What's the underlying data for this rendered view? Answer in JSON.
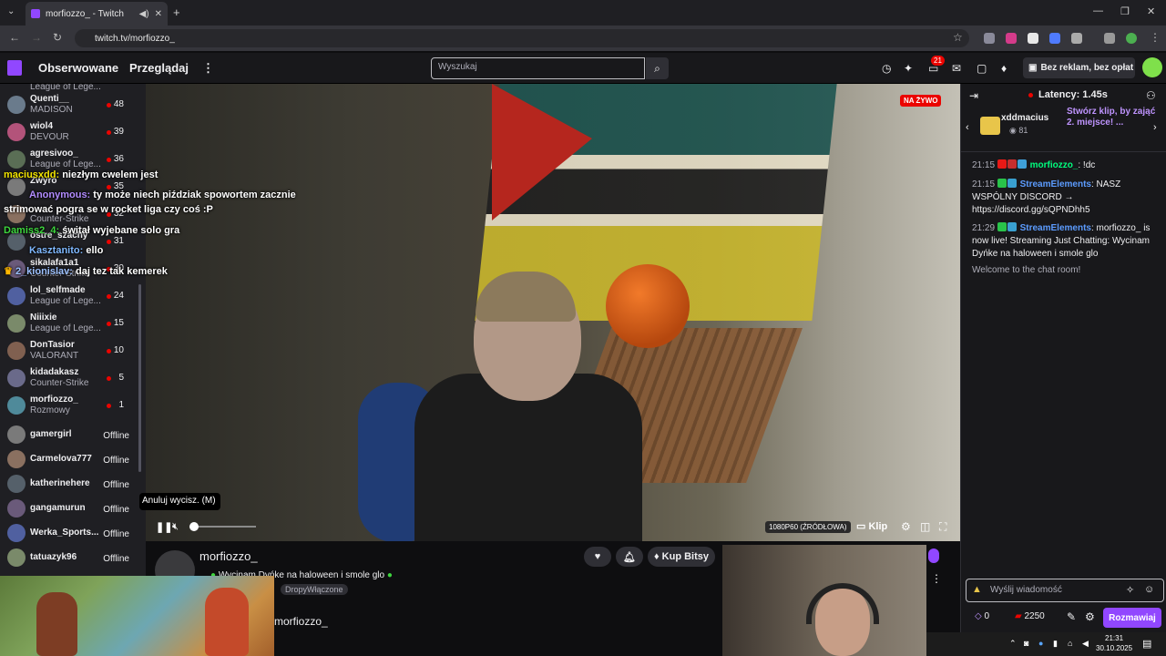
{
  "browser": {
    "tab_title": "morfiozzo_ - Twitch",
    "url": "twitch.tv/morfiozzo_"
  },
  "nav": {
    "following": "Obserwowane",
    "browse": "Przeglądaj",
    "search_placeholder": "Wyszukaj",
    "notif_count": "21",
    "adfree": "Bez reklam, bez opłat"
  },
  "sidebar": {
    "top_partial": "League of Lege...",
    "channels": [
      {
        "name": "Quenti__",
        "game": "MADISON",
        "viewers": "48"
      },
      {
        "name": "wiol4",
        "game": "DEVOUR",
        "viewers": "39"
      },
      {
        "name": "agresivoo_",
        "game": "League of Lege...",
        "viewers": "36"
      },
      {
        "name": "Zwyro",
        "game": "",
        "viewers": "35"
      },
      {
        "name": "",
        "game": "Counter-Strike",
        "viewers": "32"
      },
      {
        "name": "ostre_szachy",
        "game": "",
        "viewers": "31"
      },
      {
        "name": "sikalafa1a1",
        "game": "Counter-Strike",
        "viewers": "30"
      },
      {
        "name": "lol_selfmade",
        "game": "League of Lege...",
        "viewers": "24"
      },
      {
        "name": "Niiixie",
        "game": "League of Lege...",
        "viewers": "15"
      },
      {
        "name": "DonTasior",
        "game": "VALORANT",
        "viewers": "10"
      },
      {
        "name": "kidadakasz",
        "game": "Counter-Strike",
        "viewers": "5"
      },
      {
        "name": "morfiozzo_",
        "game": "Rozmowy",
        "viewers": "1"
      }
    ],
    "offline": [
      {
        "name": "gamergirl",
        "status": "Offline"
      },
      {
        "name": "Carmelova777",
        "status": "Offline"
      },
      {
        "name": "katherinehere",
        "status": "Offline"
      },
      {
        "name": "gangamurun",
        "status": "Offline"
      },
      {
        "name": "Werka_Sports...",
        "status": "Offline"
      },
      {
        "name": "tatuazyk96",
        "status": "Offline"
      }
    ]
  },
  "overlay_chat": [
    {
      "user": "maciusxdd:",
      "text": "niezłym cwelem jest"
    },
    {
      "user": "Anonymous:",
      "text": "ty może niech piździak spowortem zacznie"
    },
    {
      "user": "",
      "text": "strimować pogra se w rocket liga czy coś :P"
    },
    {
      "user": "Damiss2_4:",
      "text": "świtał wyjebane solo gra"
    },
    {
      "user": "Kasztanito:",
      "text": "ello"
    },
    {
      "user": "2_kionislav:",
      "text": "daj tez tak kemerek"
    }
  ],
  "video": {
    "live_badge": "NA ŻYWO",
    "tooltip": "Anuluj wycisz. (M)",
    "quality": "1080P60 (ŹRÓDŁOWA)",
    "clip": "Klip",
    "volume_fraction": 0.0
  },
  "channel": {
    "name": "morfiozzo_",
    "title": "Wycinam Dyńke na haloween i smole glo",
    "tag": "DropyWłączone",
    "name_repeat": "morfiozzo_",
    "bits_label": "Kup Bitsy"
  },
  "chat": {
    "latency": "Latency: 1.45s",
    "hype_user": "xddmacius",
    "hype_count": "81",
    "hype_msg": "Stwórz klip, by zająć 2. miejsce! ...",
    "messages": [
      {
        "time": "21:15",
        "user": "morfiozzo_",
        "text": ": !dc",
        "color": "#00ff7f"
      },
      {
        "time": "21:15",
        "user": "StreamElements",
        "text": ": NASZ WSPÓLNY DISCORD → https://discord.gg/sQPNDhh5",
        "color": "#5c9cff"
      },
      {
        "time": "21:29",
        "user": "StreamElements",
        "text": ": morfiozzo_ is now live! Streaming Just Chatting: Wycinam Dyńke na haloween i smole glo",
        "color": "#5c9cff"
      }
    ],
    "welcome": "Welcome to the chat room!",
    "input_placeholder": "Wyślij wiadomość",
    "points": "0",
    "bits": "2250",
    "send_label": "Rozmawiaj"
  },
  "taskbar": {
    "time": "21:31",
    "date": "30.10.2025"
  },
  "colors": {
    "accent": "#9147ff",
    "live": "#eb0400",
    "bg": "#0e0e10"
  }
}
